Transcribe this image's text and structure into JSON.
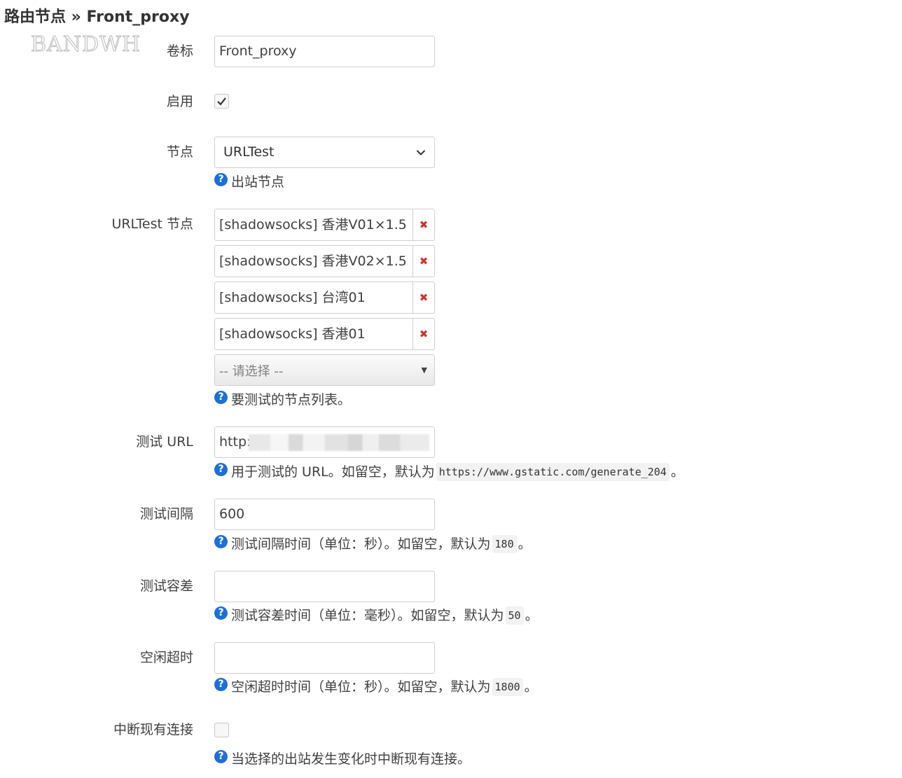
{
  "title": "路由节点 » Front_proxy",
  "watermark": "BANDWH",
  "fields": {
    "label": {
      "label": "卷标",
      "value": "Front_proxy"
    },
    "enabled": {
      "label": "启用",
      "checked": true
    },
    "node": {
      "label": "节点",
      "selected": "URLTest",
      "hint": "出站节点"
    },
    "urltest_nodes": {
      "label": "URLTest 节点",
      "items": [
        "[shadowsocks] 香港V01×1.5",
        "[shadowsocks] 香港V02×1.5",
        "[shadowsocks] 台湾01",
        "[shadowsocks] 香港01"
      ],
      "add_placeholder": "-- 请选择 --",
      "hint": "要测试的节点列表。"
    },
    "test_url": {
      "label": "测试 URL",
      "value": "http:/",
      "hint_before": "用于测试的 URL。如留空，默认为",
      "hint_code": "https://www.gstatic.com/generate_204",
      "hint_after": "。"
    },
    "test_interval": {
      "label": "测试间隔",
      "value": "600",
      "hint_before": "测试间隔时间（单位：秒）。如留空，默认为",
      "hint_code": "180",
      "hint_after": "。"
    },
    "test_tolerance": {
      "label": "测试容差",
      "value": "",
      "hint_before": "测试容差时间（单位：毫秒）。如留空，默认为",
      "hint_code": "50",
      "hint_after": "。"
    },
    "idle_timeout": {
      "label": "空闲超时",
      "value": "",
      "hint_before": "空闲超时时间（单位：秒）。如留空，默认为",
      "hint_code": "1800",
      "hint_after": "。"
    },
    "interrupt": {
      "label": "中断现有连接",
      "checked": false,
      "hint": "当选择的出站发生变化时中断现有连接。"
    }
  },
  "icons": {
    "help": "help-icon",
    "remove": "remove-icon",
    "check": "check-icon",
    "dropdown": "chevron-down-icon"
  },
  "colors": {
    "help_icon": "#1d6fd6",
    "remove_icon": "#cc3333"
  }
}
